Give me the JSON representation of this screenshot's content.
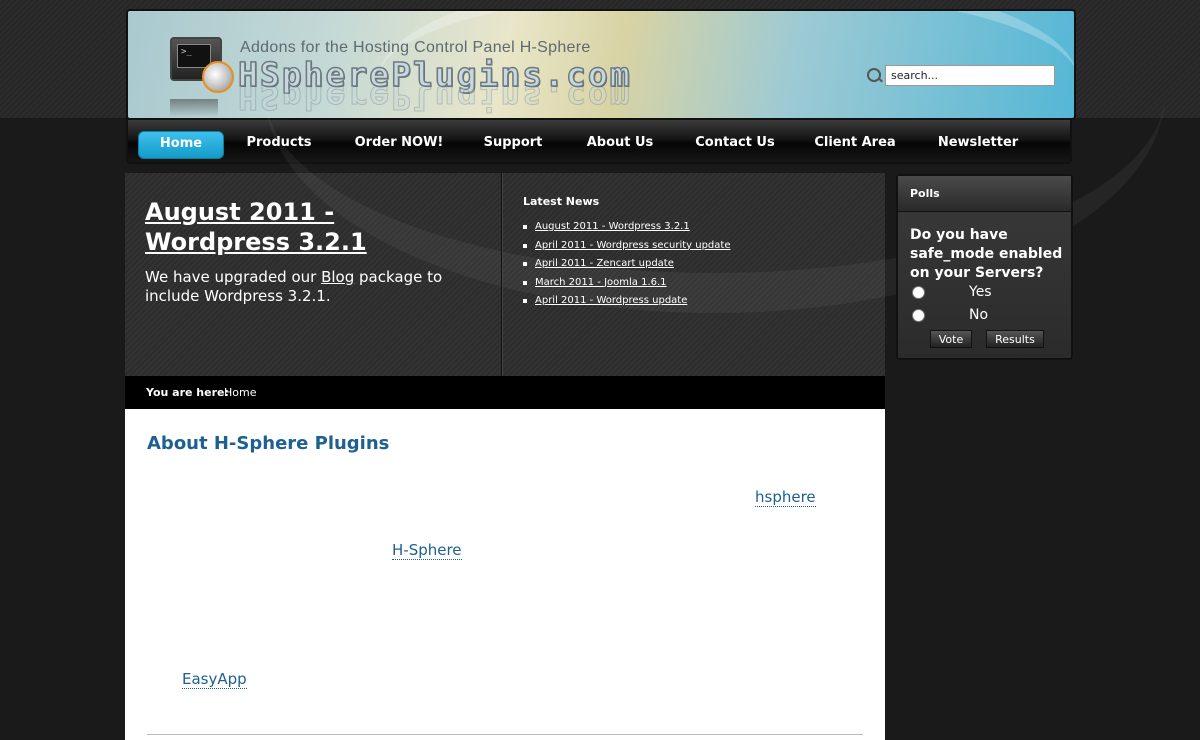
{
  "header": {
    "tagline": "Addons for the Hosting Control Panel H-Sphere",
    "site_name": "HSpherePlugins.com",
    "logo_icon": "terminal-plug-icon",
    "search": {
      "placeholder": "search...",
      "value": "search...",
      "icon": "magnifier-icon"
    }
  },
  "nav": {
    "items": [
      {
        "label": "Home",
        "active": true
      },
      {
        "label": "Products"
      },
      {
        "label": "Order NOW!"
      },
      {
        "label": "Support"
      },
      {
        "label": "About Us"
      },
      {
        "label": "Contact Us"
      },
      {
        "label": "Client Area"
      },
      {
        "label": "Newsletter"
      }
    ]
  },
  "feature": {
    "title": "August 2011 - Wordpress 3.2.1",
    "text_before": "We have upgraded our ",
    "text_link": "Blog",
    "text_after": " package to include Wordpress 3.2.1."
  },
  "news": {
    "title": "Latest News",
    "items": [
      "August 2011 - Wordpress 3.2.1",
      "April 2011 - Wordpress security update",
      "April 2011 - Zencart update",
      "March 2011 - Joomla 1.6.1",
      "April 2011 - Wordpress update"
    ]
  },
  "breadcrumb": {
    "label": "You are here:",
    "current": "Home"
  },
  "content": {
    "title": "About H-Sphere Plugins",
    "links": [
      "hsphere",
      "H-Sphere",
      "EasyApp"
    ]
  },
  "polls": {
    "heading": "Polls",
    "question": "Do you have safe_mode enabled on your Servers?",
    "options": [
      "Yes",
      "No"
    ],
    "vote_label": "Vote",
    "results_label": "Results"
  },
  "colors": {
    "accent": "#139bc8",
    "link": "#1e6090",
    "background": "#1b1b1b"
  }
}
